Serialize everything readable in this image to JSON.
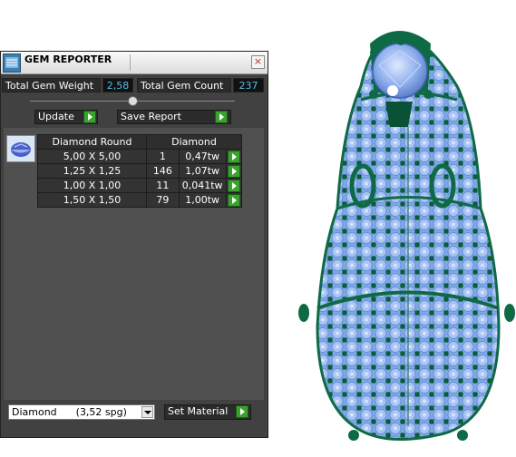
{
  "window": {
    "title": "GEM REPORTER",
    "close_label": "×"
  },
  "stats": {
    "weight_label": "Total Gem Weight",
    "weight_value": "2,58",
    "count_label": "Total Gem Count",
    "count_value": "237"
  },
  "toolbar": {
    "update_label": "Update",
    "save_report_label": "Save Report"
  },
  "gem_table": {
    "headers": [
      "Diamond Round",
      "Diamond"
    ],
    "rows": [
      {
        "size": "5,00 X 5,00",
        "count": "1",
        "weight": "0,47tw"
      },
      {
        "size": "1,25 X 1,25",
        "count": "146",
        "weight": "1,07tw"
      },
      {
        "size": "1,00 X 1,00",
        "count": "11",
        "weight": "0,041tw"
      },
      {
        "size": "1,50 X 1,50",
        "count": "79",
        "weight": "1,00tw"
      }
    ]
  },
  "material": {
    "selected": "Diamond      (3,52 spg)",
    "set_label": "Set Material"
  },
  "icons": [
    "app-logo-icon",
    "close-icon",
    "gem-icon",
    "play-arrow-icon",
    "dropdown-arrow-icon"
  ],
  "colors": {
    "accent_green": "#3aa32e",
    "value_cyan": "#4ec0e8",
    "metal_green": "#0f6a45",
    "gem_blue": "#8fb3ea"
  }
}
